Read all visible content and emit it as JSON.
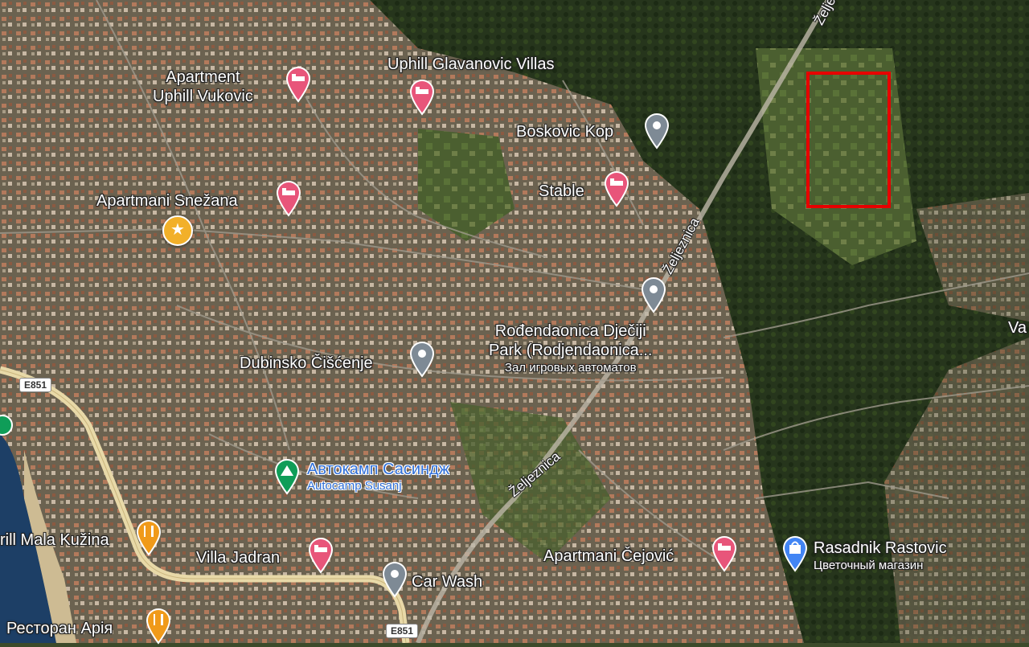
{
  "map": {
    "colors": {
      "highlight": "#e60000",
      "lodging_pin": "#e8557a",
      "generic_pin": "#7e8a95",
      "food_pin": "#f09a1a",
      "campsite_pin": "#0f9d58",
      "shopping_pin": "#4285f4",
      "road_main": "#e8d9a8"
    },
    "places": {
      "apartment_uphill_vukovic": {
        "line1": "Apartment",
        "line2": "Uphill Vukovic",
        "icon": "bed-icon"
      },
      "uphill_glavanovic": {
        "name": "Uphill Glavanovic Villas",
        "icon": "bed-icon"
      },
      "boskovic_kop": {
        "name": "Boskovic Kop",
        "icon": "pin-icon"
      },
      "stable": {
        "name": "Stable",
        "icon": "bed-icon"
      },
      "apartmani_snezana": {
        "name": "Apartmani Snežana",
        "icon": "bed-icon"
      },
      "rodendaonica": {
        "line1": "Rođendaonica Dječiji",
        "line2": "Park (Rodjendaonica...",
        "line3": "Зал игровых автоматов",
        "icon": "pin-icon"
      },
      "dubinsko": {
        "name": "Dubinsko Čišćenje",
        "icon": "pin-icon"
      },
      "autocamp": {
        "line1": "Автокамп Сасиндж",
        "line2": "Autocamp Susanj",
        "icon": "campsite-icon"
      },
      "grill_mala": {
        "name": "rill Mala Kužina",
        "icon": "restaurant-icon"
      },
      "villa_jadran": {
        "name": "Villa Jadran",
        "icon": "bed-icon"
      },
      "car_wash": {
        "name": "Car Wash",
        "icon": "pin-icon"
      },
      "apartmani_cejovic": {
        "name": "Apartmani Čejović",
        "icon": "bed-icon"
      },
      "rasadnik": {
        "line1": "Rasadnik Rastovic",
        "line2": "Цветочный магазин",
        "icon": "shopping-bag-icon"
      },
      "restoran_aria": {
        "name": "Ресторан Арія",
        "icon": "restaurant-icon"
      },
      "va_partial": {
        "name": "Va"
      }
    },
    "roads": {
      "e851_a": "E851",
      "e851_b": "E851"
    },
    "rail": {
      "top": "Željezn",
      "middle": "Željeznica",
      "lower": "Željeznica"
    }
  }
}
